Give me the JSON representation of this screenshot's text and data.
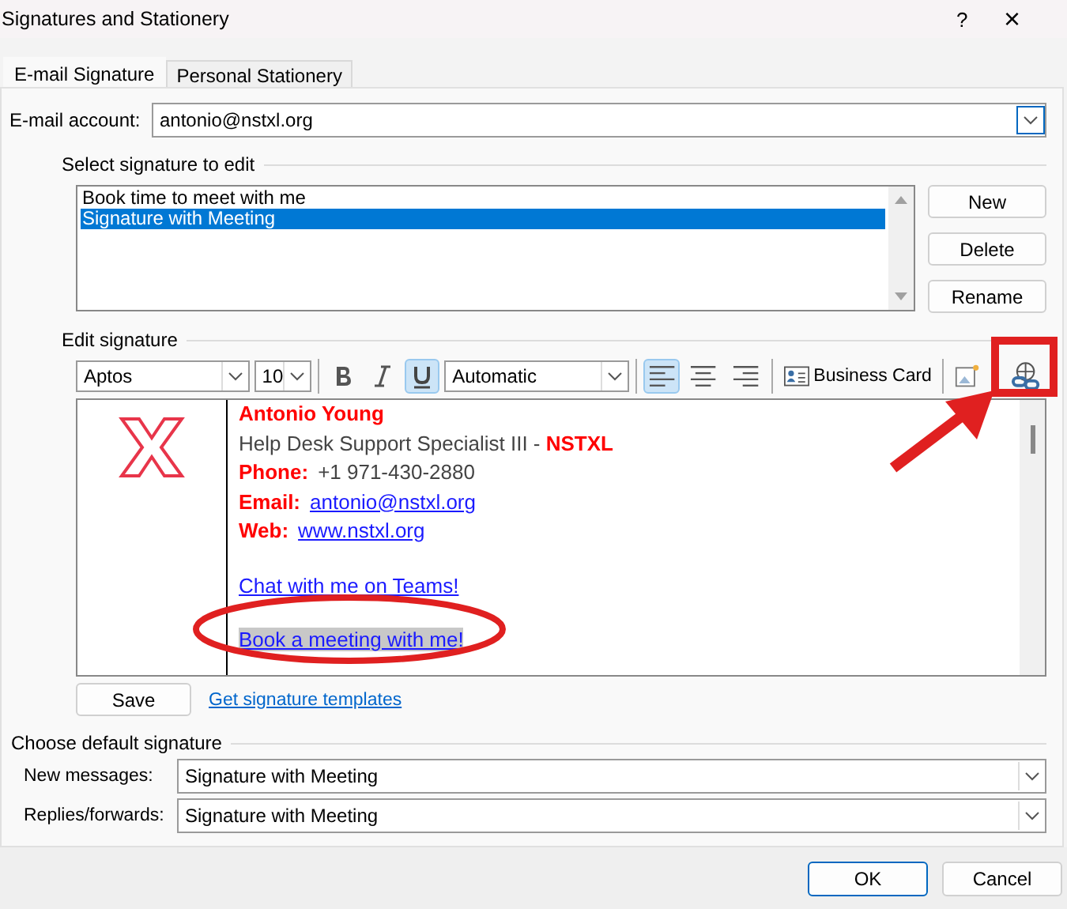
{
  "window": {
    "title": "Signatures and Stationery",
    "help": "?",
    "close": "×"
  },
  "tabs": [
    {
      "label": "E-mail Signature",
      "selected": true
    },
    {
      "label": "Personal Stationery",
      "selected": false
    }
  ],
  "account": {
    "label": "E-mail account:",
    "value": "antonio@nstxl.org"
  },
  "select_group": {
    "title": "Select signature to edit",
    "items": [
      {
        "label": "Book time to meet with me",
        "selected": false
      },
      {
        "label": "Signature with Meeting",
        "selected": true
      }
    ],
    "buttons": [
      "New",
      "Delete",
      "Rename"
    ]
  },
  "edit_group": {
    "title": "Edit signature",
    "toolbar": {
      "font": "Aptos",
      "size": "10",
      "bold": false,
      "italic": false,
      "underline": true,
      "font_color_label": "Automatic",
      "alignments": [
        {
          "kind": "left",
          "selected": true
        },
        {
          "kind": "center",
          "selected": false
        },
        {
          "kind": "right",
          "selected": false
        }
      ],
      "business_card": "Business Card"
    },
    "signature": [
      {
        "segments": [
          {
            "text": "Antonio Young",
            "kind": "name"
          }
        ]
      },
      {
        "segments": [
          {
            "text": "Help Desk Support Specialist III - ",
            "kind": "plain"
          },
          {
            "text": "NSTXL",
            "kind": "brand"
          }
        ]
      },
      {
        "segments": [
          {
            "text": "Phone:",
            "kind": "label"
          },
          {
            "text": "+1 971-430-2880",
            "kind": "plain"
          }
        ]
      },
      {
        "segments": [
          {
            "text": "Email:",
            "kind": "label"
          },
          {
            "text": "antonio@nstxl.org",
            "kind": "link"
          }
        ]
      },
      {
        "segments": [
          {
            "text": "Web:",
            "kind": "label"
          },
          {
            "text": "www.nstxl.org",
            "kind": "link"
          }
        ]
      },
      {
        "gap_before": true,
        "segments": [
          {
            "text": "Chat with me on Teams!",
            "kind": "link"
          }
        ]
      },
      {
        "gap_before": true,
        "highlighted": true,
        "segments": [
          {
            "text": "Book a meeting with me!",
            "kind": "link"
          }
        ]
      }
    ],
    "save": "Save",
    "templates_link": "Get signature templates"
  },
  "defaults": {
    "title": "Choose default signature",
    "rows": [
      {
        "label": "New messages:",
        "value": "Signature with Meeting"
      },
      {
        "label": "Replies/forwards:",
        "value": "Signature with Meeting"
      }
    ]
  },
  "footer_buttons": [
    "OK",
    "Cancel"
  ],
  "annotations": [
    {
      "kind": "ellipse"
    },
    {
      "kind": "arrow"
    },
    {
      "kind": "box"
    }
  ]
}
